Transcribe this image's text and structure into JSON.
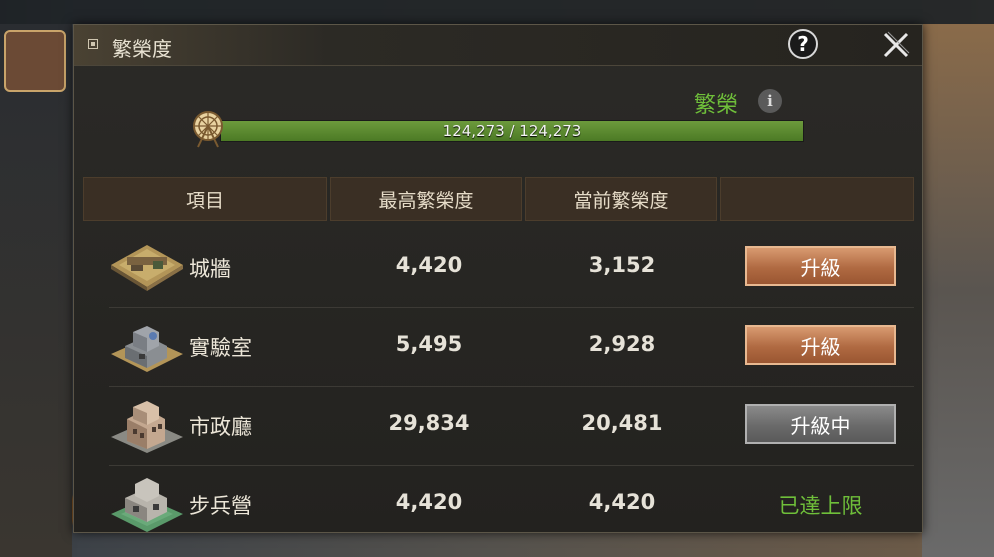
{
  "window": {
    "title": "繁榮度"
  },
  "prosperity": {
    "label": "繁榮",
    "bar_text": "124,273 / 124,273",
    "current": 124273,
    "max": 124273,
    "bar_color": "#5c8a30"
  },
  "table": {
    "headers": [
      "項目",
      "最高繁榮度",
      "當前繁榮度",
      ""
    ],
    "rows": [
      {
        "name": "城牆",
        "max": "4,420",
        "current": "3,152",
        "action": "升級",
        "state": "upgrade"
      },
      {
        "name": "實驗室",
        "max": "5,495",
        "current": "2,928",
        "action": "升級",
        "state": "upgrade"
      },
      {
        "name": "市政廳",
        "max": "29,834",
        "current": "20,481",
        "action": "升級中",
        "state": "upgrading"
      },
      {
        "name": "步兵營",
        "max": "4,420",
        "current": "4,420",
        "action": "已達上限",
        "state": "maxed"
      }
    ]
  },
  "colors": {
    "accent_green": "#6fbf3a",
    "upgrade_button": "#c07a50",
    "upgrading_button": "#707070"
  }
}
